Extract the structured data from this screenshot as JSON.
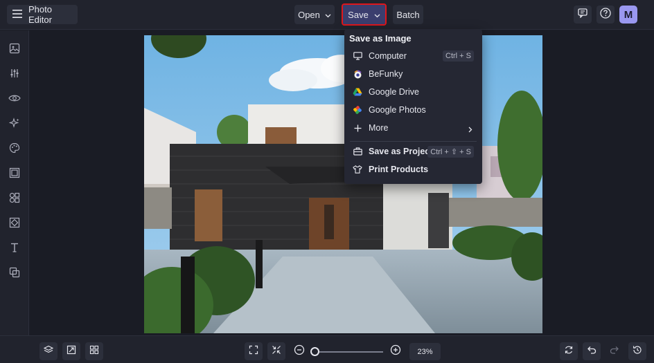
{
  "app": {
    "title": "Photo Editor",
    "avatar_initial": "M"
  },
  "toolbar": {
    "open_label": "Open",
    "save_label": "Save",
    "batch_label": "Batch"
  },
  "save_menu": {
    "heading": "Save as Image",
    "items": [
      {
        "label": "Computer",
        "shortcut": "Ctrl + S",
        "icon": "monitor-icon"
      },
      {
        "label": "BeFunky",
        "icon": "befunky-icon"
      },
      {
        "label": "Google Drive",
        "icon": "google-drive-icon"
      },
      {
        "label": "Google Photos",
        "icon": "google-photos-icon"
      },
      {
        "label": "More",
        "icon": "plus-icon"
      }
    ],
    "project_items": [
      {
        "label": "Save as Project",
        "shortcut": "Ctrl + ⇧ + S",
        "icon": "briefcase-icon"
      },
      {
        "label": "Print Products",
        "icon": "tshirt-icon"
      }
    ]
  },
  "zoom": {
    "value_label": "23%",
    "level": 0.02
  },
  "colors": {
    "accent": "#3b3e6e",
    "highlight": "#e0161b",
    "avatar": "#9a98f0"
  }
}
